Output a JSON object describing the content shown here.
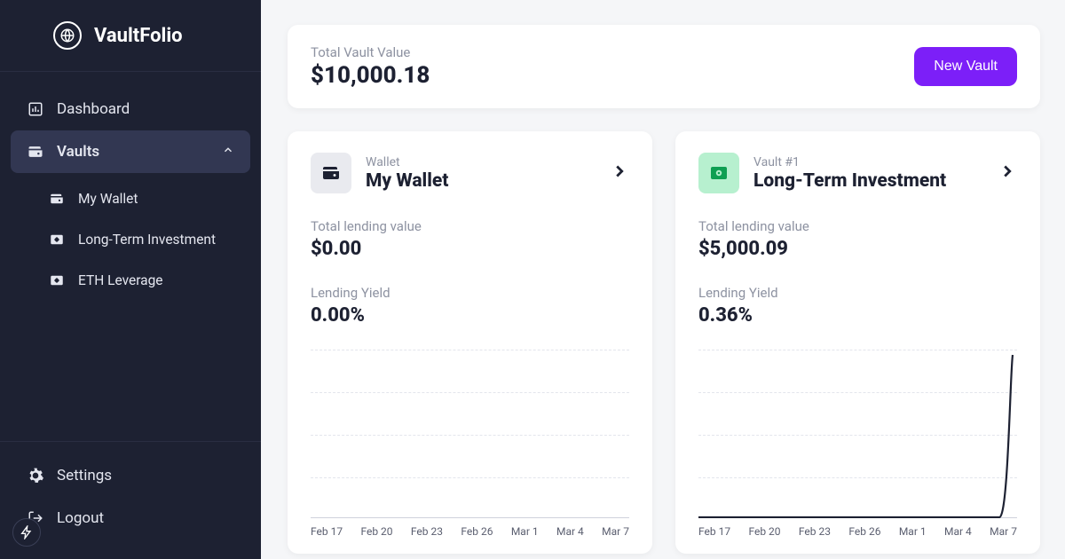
{
  "brand": {
    "name": "VaultFolio"
  },
  "sidebar": {
    "items": [
      {
        "label": "Dashboard"
      },
      {
        "label": "Vaults"
      }
    ],
    "subitems": [
      {
        "label": "My Wallet"
      },
      {
        "label": "Long-Term Investment"
      },
      {
        "label": "ETH Leverage"
      }
    ],
    "bottom": [
      {
        "label": "Settings"
      },
      {
        "label": "Logout"
      }
    ]
  },
  "summary": {
    "label": "Total Vault Value",
    "value": "$10,000.18",
    "button": "New Vault"
  },
  "vaults": [
    {
      "sub": "Wallet",
      "title": "My Wallet",
      "lending_label": "Total lending value",
      "lending_value": "$0.00",
      "yield_label": "Lending Yield",
      "yield_value": "0.00%"
    },
    {
      "sub": "Vault #1",
      "title": "Long-Term Investment",
      "lending_label": "Total lending value",
      "lending_value": "$5,000.09",
      "yield_label": "Lending Yield",
      "yield_value": "0.36%"
    }
  ],
  "chart_data": [
    {
      "type": "line",
      "categories": [
        "Feb 17",
        "Feb 20",
        "Feb 23",
        "Feb 26",
        "Mar 1",
        "Mar 4",
        "Mar 7"
      ],
      "values": [
        0,
        0,
        0,
        0,
        0,
        0,
        0
      ],
      "ylim": [
        0,
        1
      ]
    },
    {
      "type": "line",
      "categories": [
        "Feb 17",
        "Feb 20",
        "Feb 23",
        "Feb 26",
        "Mar 1",
        "Mar 4",
        "Mar 7"
      ],
      "values": [
        0,
        0,
        0,
        0,
        0,
        0,
        5000
      ],
      "ylim": [
        0,
        5200
      ]
    }
  ],
  "colors": {
    "accent": "#7c1ff8",
    "sidebar": "#1d2132"
  }
}
